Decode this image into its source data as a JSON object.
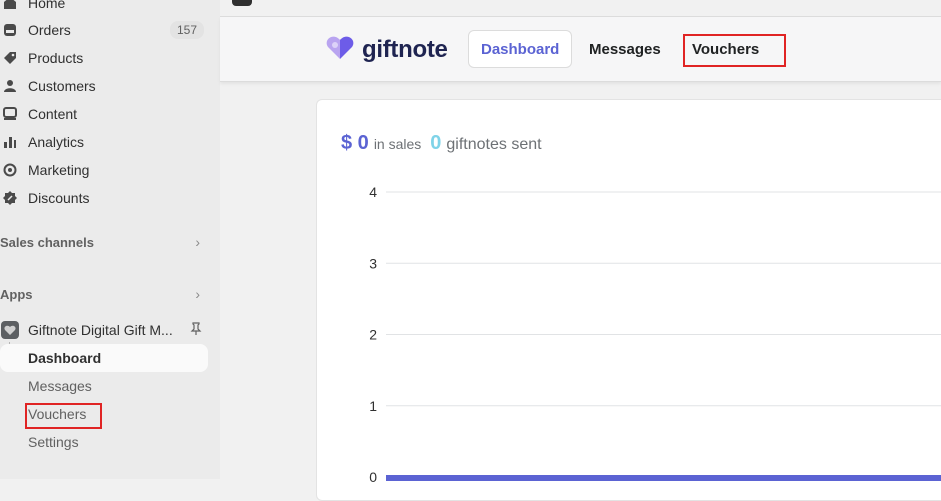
{
  "sidebar": {
    "nav": [
      {
        "label": "Home",
        "icon": "home-icon"
      },
      {
        "label": "Orders",
        "icon": "orders-icon",
        "badge": "157"
      },
      {
        "label": "Products",
        "icon": "tag-icon"
      },
      {
        "label": "Customers",
        "icon": "person-icon"
      },
      {
        "label": "Content",
        "icon": "content-icon"
      },
      {
        "label": "Analytics",
        "icon": "bar-chart-icon"
      },
      {
        "label": "Marketing",
        "icon": "target-icon"
      },
      {
        "label": "Discounts",
        "icon": "discount-icon"
      }
    ],
    "sales_channels": "Sales channels",
    "apps": "Apps",
    "app_name": "Giftnote Digital Gift M...",
    "app_sub": [
      "Dashboard",
      "Messages",
      "Vouchers",
      "Settings"
    ]
  },
  "header": {
    "brand": "giftnote",
    "tabs": [
      "Dashboard",
      "Messages",
      "Vouchers"
    ],
    "active_tab": "Dashboard"
  },
  "stats": {
    "sales_value": "$ 0",
    "sales_label": "in sales",
    "sent_value": "0",
    "sent_label": "giftnotes sent"
  },
  "chart_data": {
    "type": "bar",
    "yticks": [
      "4",
      "3",
      "2",
      "1",
      "0"
    ],
    "ylim": [
      0,
      4
    ],
    "series": [
      {
        "values": [
          0
        ]
      }
    ],
    "grid": true
  },
  "colors": {
    "accent": "#5b63d3",
    "accent_light": "#7fd3e8",
    "highlight": "#e02424"
  }
}
